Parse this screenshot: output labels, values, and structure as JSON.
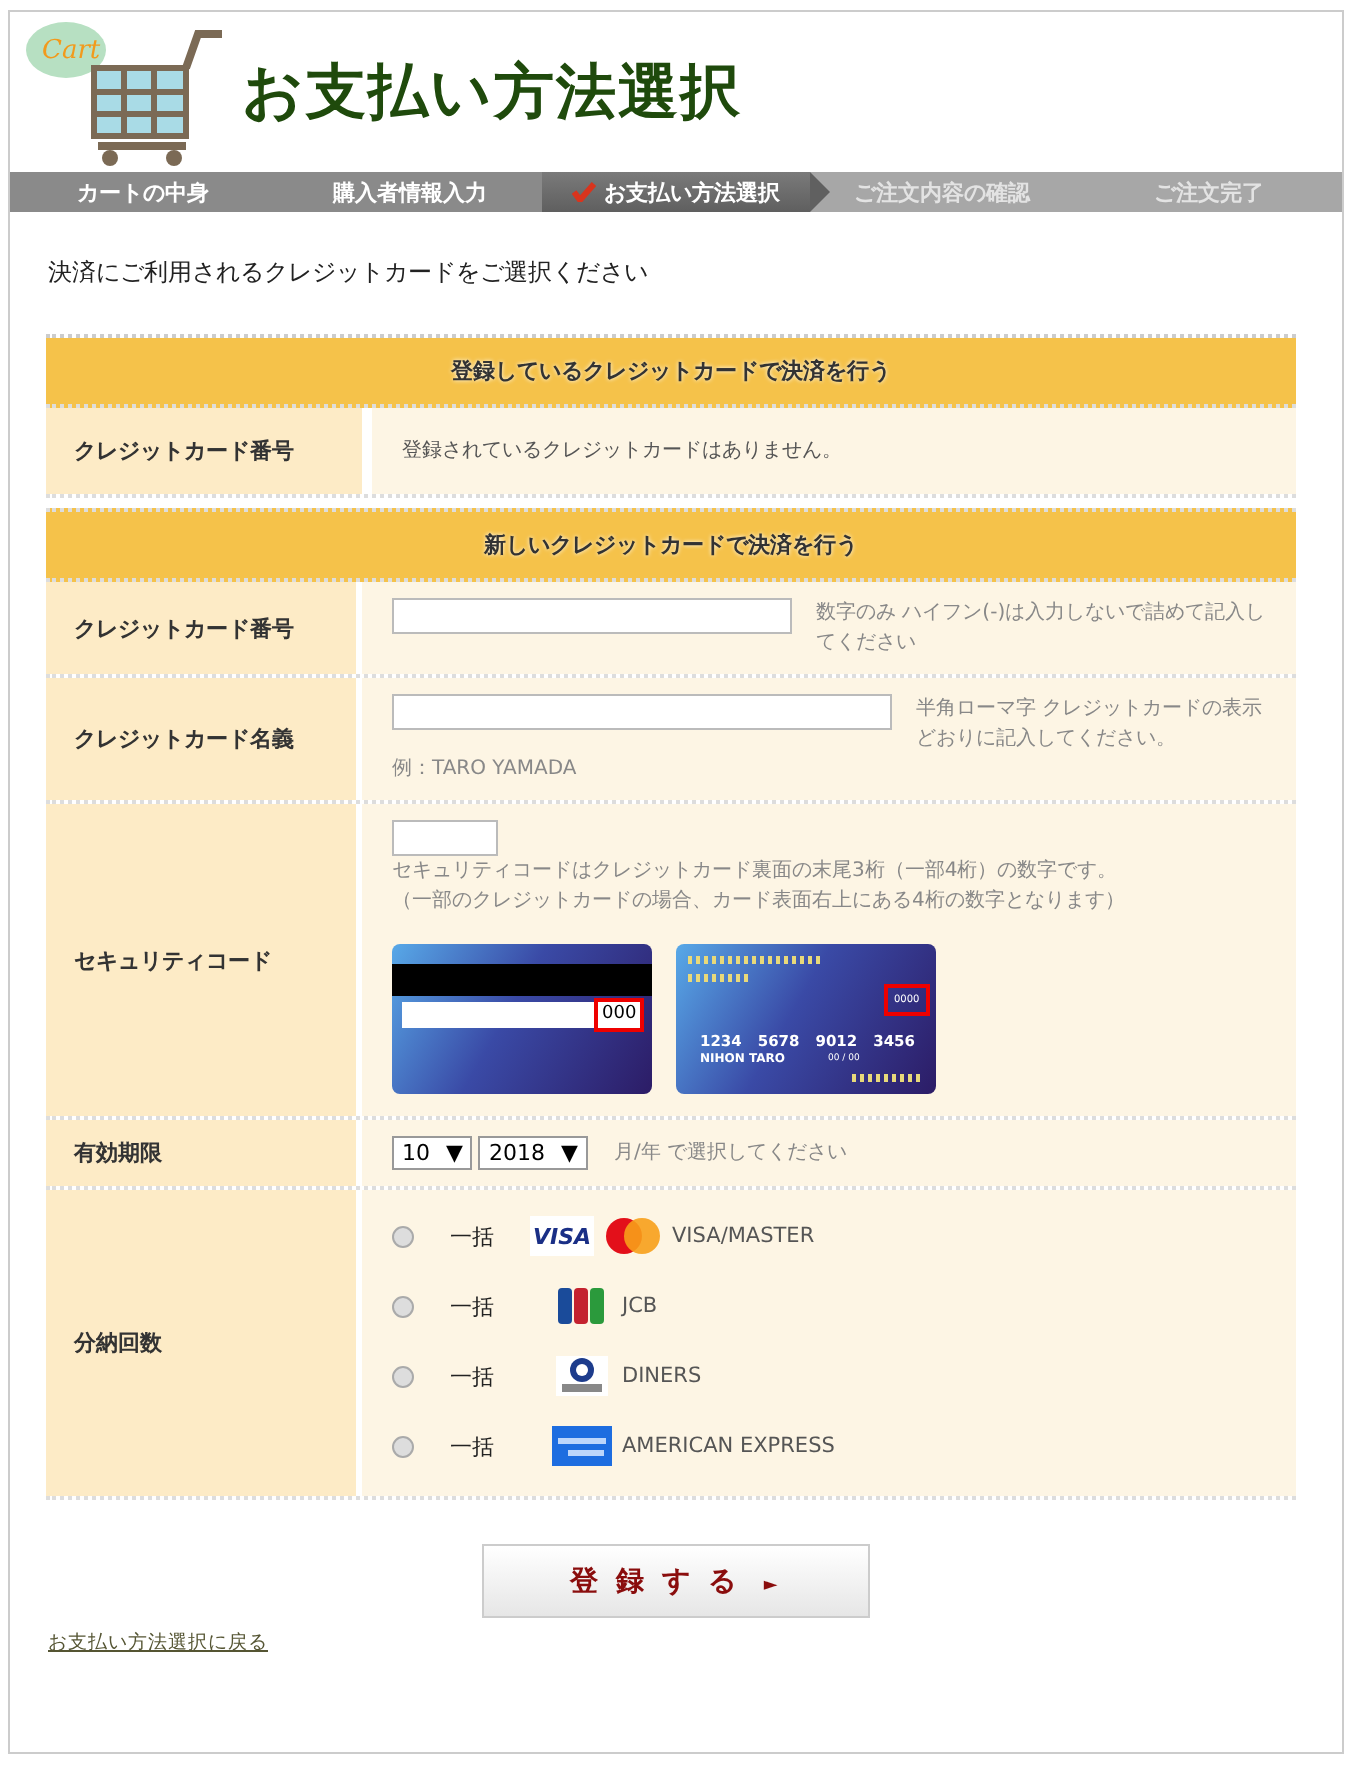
{
  "header": {
    "logo_text": "Cart",
    "title": "お支払い方法選択"
  },
  "steps": [
    {
      "label": "カートの中身",
      "selected": false,
      "reached": true
    },
    {
      "label": "購入者情報入力",
      "selected": false,
      "reached": true
    },
    {
      "label": "お支払い方法選択",
      "selected": true,
      "reached": true
    },
    {
      "label": "ご注文内容の確認",
      "selected": false,
      "reached": false
    },
    {
      "label": "ご注文完了",
      "selected": false,
      "reached": false
    }
  ],
  "intro": "決済にご利用されるクレジットカードをご選択ください",
  "registered": {
    "heading": "登録しているクレジットカードで決済を行う",
    "label": "クレジットカード番号",
    "message": "登録されているクレジットカードはありません。"
  },
  "new_card": {
    "heading": "新しいクレジットカードで決済を行う",
    "rows": [
      {
        "kind": "cardnumber",
        "label": "クレジットカード番号",
        "hint": "数字のみ ハイフン(-)は入力しないで詰めて記入してください"
      },
      {
        "kind": "cardname",
        "label": "クレジットカード名義",
        "hint": "半角ローマ字 クレジットカードの表示どおりに記入してください。",
        "example": "例：TARO YAMADA"
      },
      {
        "kind": "security",
        "label": "セキュリティコード",
        "hint": "セキュリティコードはクレジットカード裏面の末尾3桁（一部4桁）の数字です。",
        "hint2": "（一部のクレジットカードの場合、カード表面右上にある4桁の数字となります）",
        "card_back": {
          "code": "000"
        },
        "card_front": {
          "code": "0000",
          "number": "1234　5678　9012　3456",
          "holder": "NIHON TARO",
          "expiry": "00 / 00"
        }
      },
      {
        "kind": "expiry",
        "label": "有効期限",
        "month": "10",
        "year": "2018",
        "arrow": "▼",
        "hint": "月/年 で選択してください"
      },
      {
        "kind": "installments",
        "label": "分納回数",
        "options": [
          {
            "selected": false,
            "plan": "一括",
            "logos": [
              {
                "kind": "visa",
                "text": "VISA"
              },
              {
                "kind": "mastercard"
              }
            ],
            "brand": "VISA/MASTER"
          },
          {
            "selected": false,
            "plan": "一括",
            "logos": [
              {
                "kind": "jcb"
              }
            ],
            "brand": "JCB"
          },
          {
            "selected": false,
            "plan": "一括",
            "logos": [
              {
                "kind": "diners"
              }
            ],
            "brand": "DINERS"
          },
          {
            "selected": false,
            "plan": "一括",
            "logos": [
              {
                "kind": "amex"
              }
            ],
            "brand": "AMERICAN EXPRESS"
          }
        ]
      }
    ]
  },
  "submit": {
    "label": "登 録 す る",
    "arrow": "►"
  },
  "back_link": "お支払い方法選択に戻る"
}
